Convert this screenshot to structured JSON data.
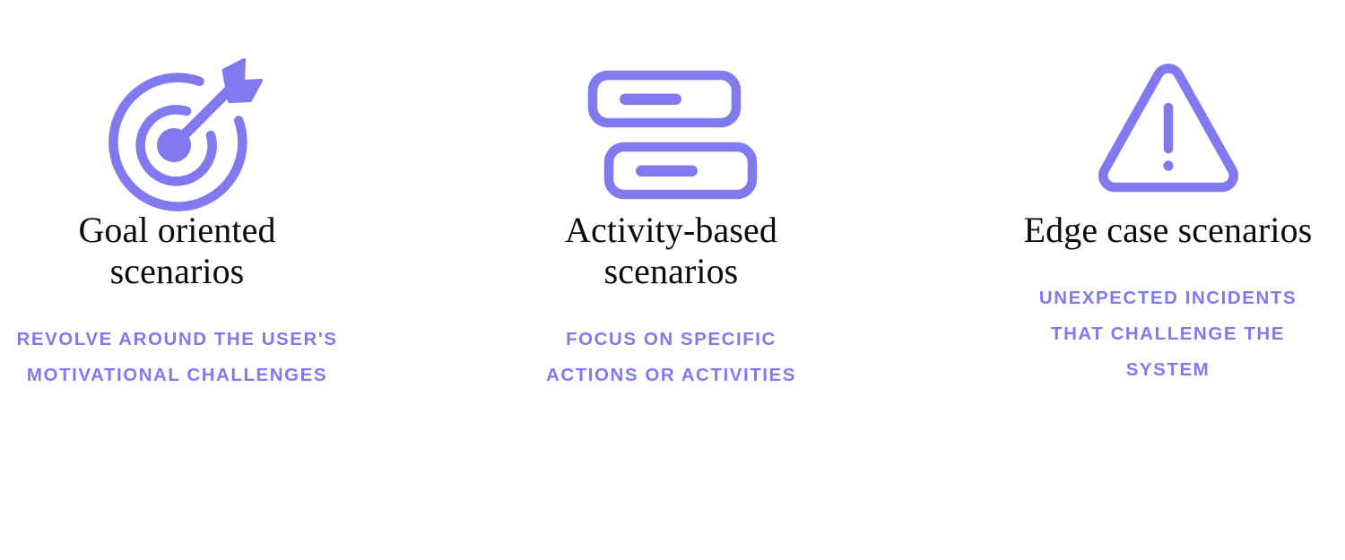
{
  "theme": {
    "background": "#ffffff",
    "accent": "#8179ef",
    "title_color": "#0b0b0c"
  },
  "cards": [
    {
      "icon": "target-arrow-icon",
      "title": "Goal oriented scenarios",
      "subtitle": "Revolve around the user's motivational challenges"
    },
    {
      "icon": "stacked-bars-icon",
      "title": "Activity-based scenarios",
      "subtitle": "Focus on specific actions or activities"
    },
    {
      "icon": "warning-triangle-icon",
      "title": "Edge case scenarios",
      "subtitle": "Unexpected incidents that challenge the system"
    }
  ]
}
